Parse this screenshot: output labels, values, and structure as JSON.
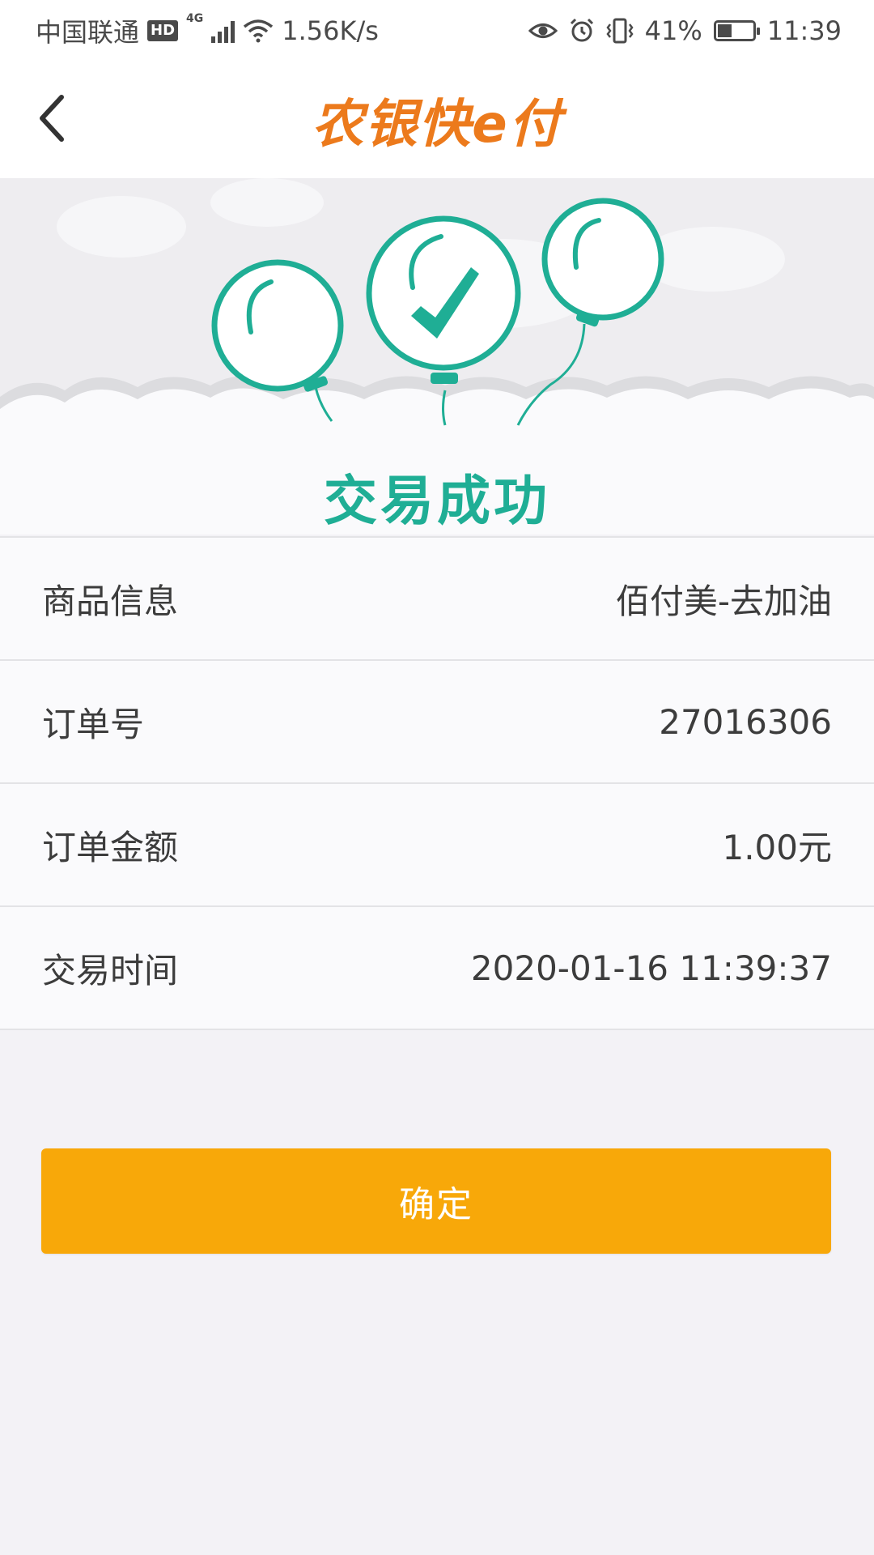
{
  "status_bar": {
    "carrier": "中国联通",
    "hd_badge": "HD",
    "network_type": "4G",
    "speed": "1.56K/s",
    "battery": "41%",
    "battery_level": 0.41,
    "time": "11:39",
    "icons": [
      "signal-icon",
      "wifi-icon",
      "eye-icon",
      "alarm-icon",
      "vibrate-icon",
      "battery-icon"
    ]
  },
  "header": {
    "back_icon": "chevron-left-icon",
    "logo_text": "农银快e付",
    "logo_color": "#ec7a1c"
  },
  "result": {
    "title": "交易成功",
    "accent_color": "#1fae95",
    "illustration": "balloons-check-icon"
  },
  "details": [
    {
      "label": "商品信息",
      "value": "佰付美-去加油"
    },
    {
      "label": "订单号",
      "value": "27016306"
    },
    {
      "label": "订单金额",
      "value": "1.00元"
    },
    {
      "label": "交易时间",
      "value": "2020-01-16 11:39:37"
    }
  ],
  "confirm_button": {
    "label": "确定",
    "color": "#f8a809"
  }
}
